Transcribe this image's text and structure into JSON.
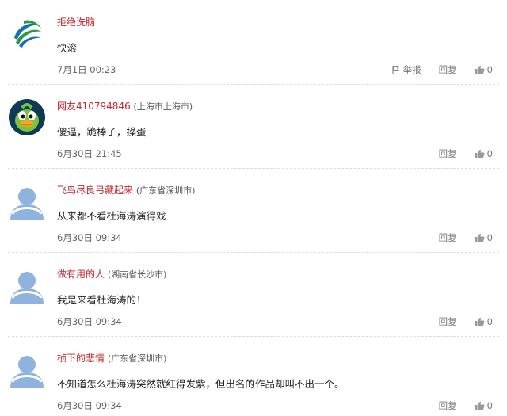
{
  "comments": [
    {
      "avatar": "china-mobile-logo",
      "username": "拒绝洗脑",
      "location": "",
      "content": "快滚",
      "time": "7月1日 00:23",
      "report_label": "举报",
      "reply_label": "回复",
      "likes": "0"
    },
    {
      "avatar": "green-bird-avatar",
      "username": "网友410794846",
      "location": "(上海市上海市)",
      "content": "傻逼，跪棒子，操蛋",
      "time": "6月30日 21:45",
      "reply_label": "回复",
      "likes": "0"
    },
    {
      "avatar": "default-user-avatar",
      "username": "飞鸟尽良弓藏起来",
      "location": "(广东省深圳市)",
      "content": "从来都不看杜海涛演得戏",
      "time": "6月30日 09:34",
      "reply_label": "回复",
      "likes": "0"
    },
    {
      "avatar": "default-user-avatar",
      "username": "做有用的人",
      "location": "(湖南省长沙市)",
      "content": "我是来看杜海涛的！",
      "time": "6月30日 09:34",
      "reply_label": "回复",
      "likes": "0"
    },
    {
      "avatar": "default-user-avatar",
      "username": "桢下的悲情",
      "location": "(广东省深圳市)",
      "content": "不知道怎么杜海涛突然就红得发紫，但出名的作品却叫不出一个。",
      "time": "6月30日 09:34",
      "reply_label": "回复",
      "likes": "0"
    }
  ],
  "icons": {
    "report": "flag-icon",
    "like": "thumbs-up-icon"
  },
  "colors": {
    "username": "#c1272d",
    "text": "#222222",
    "meta": "#666666",
    "divider": "#dcdcdc"
  }
}
